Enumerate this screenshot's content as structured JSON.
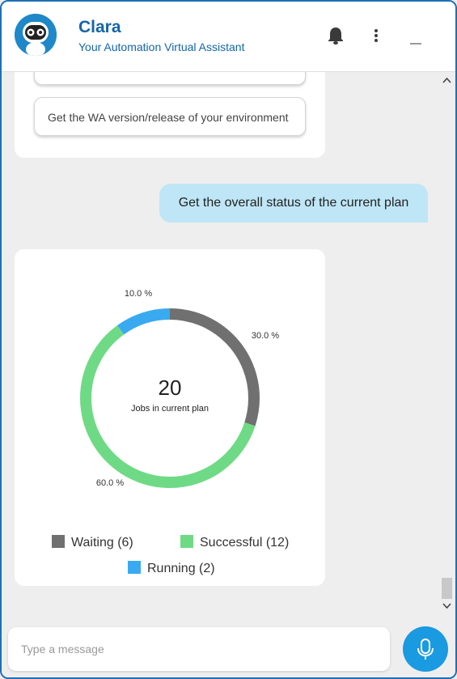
{
  "header": {
    "title": "Clara",
    "subtitle": "Your Automation Virtual Assistant",
    "icons": [
      "bell-icon",
      "more-vert-icon",
      "minimize-icon"
    ]
  },
  "chat": {
    "suggestion_chip": "Get the WA version/release of your environment",
    "user_message": "Get the overall status of the current plan",
    "chart_center": {
      "value": "20",
      "label": "Jobs in current plan"
    },
    "legend": {
      "waiting": "Waiting (6)",
      "successful": "Successful (12)",
      "running": "Running (2)"
    }
  },
  "chart_data": {
    "type": "pie",
    "donut": true,
    "categories": [
      "Waiting",
      "Successful",
      "Running"
    ],
    "values": [
      6,
      12,
      2
    ],
    "percent_labels": [
      "30.0 %",
      "60.0 %",
      "10.0 %"
    ],
    "colors": [
      "#707070",
      "#6fda85",
      "#3aaaf0"
    ],
    "total": 20,
    "legend_position": "bottom"
  },
  "footer": {
    "input_placeholder": "Type a message",
    "input_value": ""
  },
  "colors": {
    "brand": "#1565a8",
    "border": "#1e6fb5",
    "user_bubble": "#bfe6f6",
    "mic": "#1a9ae0"
  }
}
